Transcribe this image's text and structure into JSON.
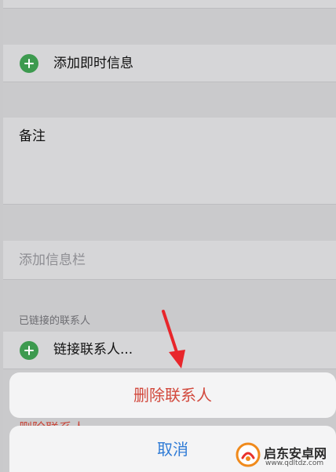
{
  "contact": {
    "add_instant_message": "添加即时信息",
    "notes_label": "备注",
    "add_field": "添加信息栏",
    "linked_header": "已链接的联系人",
    "link_contact": "链接联系人...",
    "delete_behind": "删除联系人"
  },
  "action_sheet": {
    "delete_label": "删除联系人",
    "cancel_label": "取消"
  },
  "watermark": {
    "name": "启东安卓网",
    "url": "www.qdltdz.com"
  },
  "colors": {
    "destructive": "#d2493d",
    "action_blue": "#2f7bd6",
    "plus_green": "#3d9a4f",
    "arrow_red": "#e8262b"
  }
}
